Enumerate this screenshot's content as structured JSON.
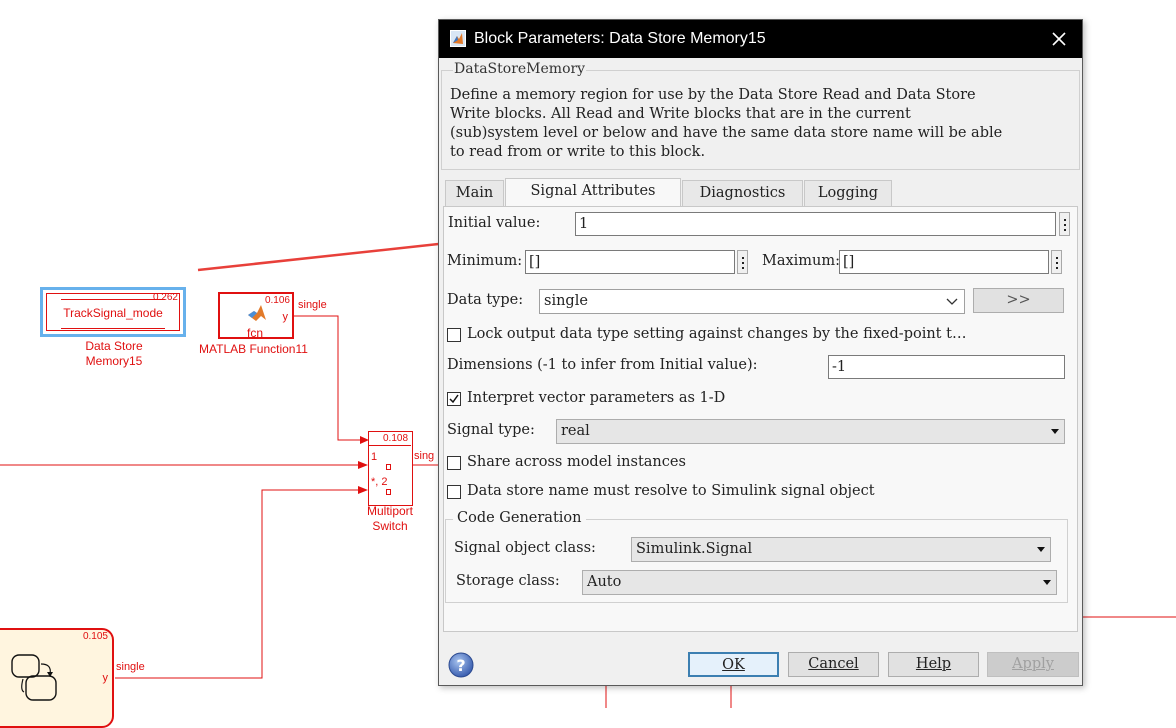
{
  "canvas": {
    "dsm_block": {
      "signal_name": "TrackSignal_mode",
      "sample_time": "0.262",
      "name_line1": "Data Store",
      "name_line2": "Memory15"
    },
    "matlab_fn": {
      "label": "fcn",
      "port": "y",
      "sample_time": "0.106",
      "name": "MATLAB Function11",
      "out_signal": "single"
    },
    "switch": {
      "sample_time": "0.108",
      "port1": "1",
      "port2": "*, 2",
      "name_line1": "Multiport",
      "name_line2": "Switch",
      "out_signal": "sing"
    },
    "chart": {
      "sample_time": "0.105",
      "port": "y",
      "out_signal": "single"
    }
  },
  "dialog": {
    "title": "Block Parameters: Data Store Memory15",
    "group": "DataStoreMemory",
    "description": "Define a memory region for use by the Data Store Read and Data Store\nWrite blocks. All Read and Write blocks that are in the current\n(sub)system level or below and have the same data store name will be able\nto read from or write to this block.",
    "tabs": [
      "Main",
      "Signal Attributes",
      "Diagnostics",
      "Logging"
    ],
    "active_tab": "Signal Attributes",
    "initial_value": {
      "label": "Initial value:",
      "value": "1"
    },
    "minimum": {
      "label": "Minimum:",
      "value": "[]"
    },
    "maximum": {
      "label": "Maximum:",
      "value": "[]"
    },
    "data_type": {
      "label": "Data type:",
      "value": "single",
      "assistant_button": ">>"
    },
    "lock_output": {
      "label": "Lock output data type setting against changes by the fixed-point t…",
      "checked": false
    },
    "dimensions": {
      "label": "Dimensions (-1 to infer from Initial value):",
      "value": "-1"
    },
    "interpret_vector": {
      "label": "Interpret vector parameters as 1-D",
      "checked": true
    },
    "signal_type": {
      "label": "Signal type:",
      "value": "real"
    },
    "share_instances": {
      "label": "Share across model instances",
      "checked": false
    },
    "resolve_name": {
      "label": "Data store name must resolve to Simulink signal object",
      "checked": false
    },
    "code_generation": {
      "header": "Code Generation",
      "signal_object_class": {
        "label": "Signal object class:",
        "value": "Simulink.Signal"
      },
      "storage_class": {
        "label": "Storage class:",
        "value": "Auto"
      }
    },
    "buttons": {
      "ok": "OK",
      "cancel": "Cancel",
      "help": "Help",
      "apply": "Apply"
    }
  },
  "colors": {
    "signal_line": "#e01010",
    "arrow": "#e8403a",
    "selection": "#67b1ec",
    "titlebar": "#000000"
  }
}
